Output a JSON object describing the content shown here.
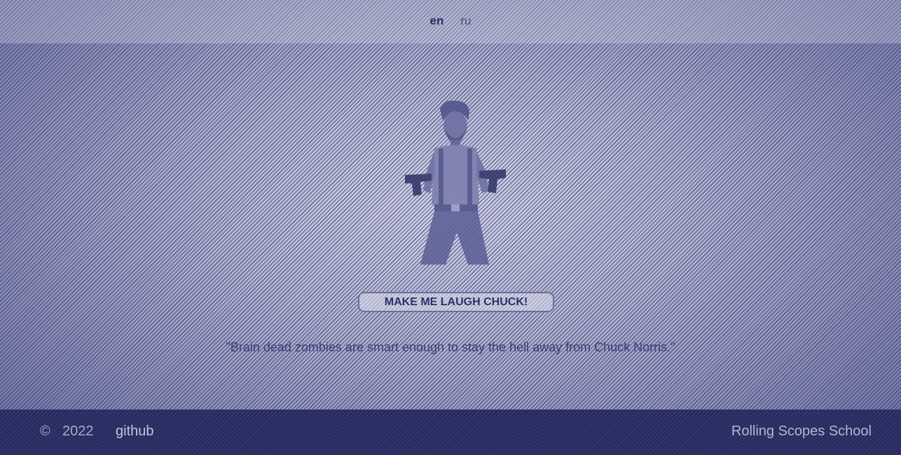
{
  "header": {
    "languages": [
      {
        "label": "en",
        "active": true
      },
      {
        "label": "ru",
        "active": false
      }
    ]
  },
  "main": {
    "image_icon": "chuck-norris-with-guns",
    "button_label": "MAKE ME LAUGH CHUCK!",
    "quote": "\"Brain dead zombies are smart enough to stay the hell away from Chuck Norris.\""
  },
  "footer": {
    "copyright_symbol": "©",
    "year": "2022",
    "github_label": "github",
    "school_label": "Rolling Scopes School"
  },
  "colors": {
    "accent": "#2d3167",
    "footer_bg": "#262a5c",
    "background": "#b7b9d2"
  }
}
